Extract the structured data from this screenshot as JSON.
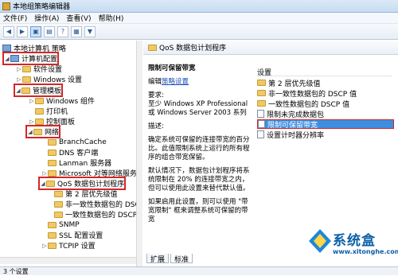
{
  "window": {
    "title": "本地组策略编辑器"
  },
  "menu": [
    "文件(F)",
    "操作(A)",
    "查看(V)",
    "帮助(H)"
  ],
  "toolbar": {
    "icons": [
      "back-icon",
      "forward-icon",
      "folder-up-icon",
      "properties-icon",
      "help-icon",
      "view-icon",
      "filter-icon"
    ]
  },
  "tree": {
    "root": "本地计算机 策略",
    "items": [
      {
        "label": "计算机配置"
      },
      {
        "label": "软件设置"
      },
      {
        "label": "Windows 设置"
      },
      {
        "label": "管理模板"
      },
      {
        "label": "Windows 组件"
      },
      {
        "label": "打印机"
      },
      {
        "label": "控制面板"
      },
      {
        "label": "网络"
      },
      {
        "label": "BranchCache"
      },
      {
        "label": "DNS 客户端"
      },
      {
        "label": "Lanman 服务器"
      },
      {
        "label": "Microsoft 对等网络服务"
      },
      {
        "label": "QoS 数据包计划程序"
      },
      {
        "label": "第 2 层优先级值"
      },
      {
        "label": "非一致性数据包的 DSCI"
      },
      {
        "label": "一致性数据包的 DSCP 值"
      },
      {
        "label": "SNMP"
      },
      {
        "label": "SSL 配置设置"
      },
      {
        "label": "TCPIP 设置"
      }
    ]
  },
  "right": {
    "header": "QoS 数据包计划程序",
    "policy_title": "限制可保留带宽",
    "edit_prefix": "编辑",
    "edit_link": "策略设置",
    "req_label": "要求:",
    "req_text": "至少 Windows XP Professional 或 Windows Server 2003 系列",
    "desc_label": "描述:",
    "desc_text": "确定系统可保留的连接带宽的百分比。此值限制系统上运行的所有程序的组合带宽保留。",
    "desc_text2": "默认情况下，数据包计划程序将系统限制在 20% 的连接带宽之内，但可以使用此设置来替代默认值。",
    "desc_text3": "如果启用此设置，则可以使用 \"带宽限制\" 框来调整系统可保留的带宽",
    "col_header": "设置",
    "list": [
      {
        "label": "第 2 层优先级值"
      },
      {
        "label": "非一致性数据包的 DSCP 值"
      },
      {
        "label": "一致性数据包的 DSCP 值"
      },
      {
        "label": "限制未完成数据包"
      },
      {
        "label": "限制可保留带宽"
      },
      {
        "label": "设置计时器分辨率"
      }
    ],
    "tabs": [
      "扩展",
      "标准"
    ]
  },
  "status": "3 个设置",
  "watermark": {
    "brand": "系统盒",
    "url": "www.xitonghe.com"
  }
}
